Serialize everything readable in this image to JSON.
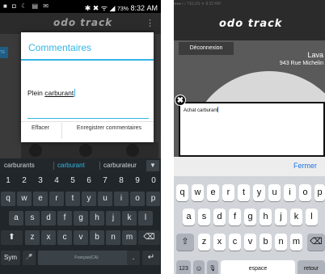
{
  "left_screen": {
    "status_bar": {
      "icons_left": "■ ◘ ☾ ▤ ✉",
      "icons_right": "✱ ✖ ᯤ ◢",
      "battery": "73%",
      "time": "8:32 AM"
    },
    "header": {
      "logo": "odo track",
      "menu_icon": "⋮",
      "edge_tab": "TE"
    },
    "dialog": {
      "title": "Commentaires",
      "text_prefix": "Plein ",
      "text_underlined": "carburant",
      "btn_clear": "Effacer",
      "btn_save": "Enregistrer commentaires"
    },
    "suggestions": {
      "s1": "carburants",
      "s2": "carburant",
      "s3": "carburateur",
      "expand_icon": "chevron-down"
    },
    "keyboard": {
      "numbers": [
        "1",
        "2",
        "3",
        "4",
        "5",
        "6",
        "7",
        "8",
        "9",
        "0"
      ],
      "row1": [
        "q",
        "w",
        "e",
        "r",
        "t",
        "y",
        "u",
        "i",
        "o",
        "p"
      ],
      "row2": [
        "a",
        "s",
        "d",
        "f",
        "g",
        "h",
        "j",
        "k",
        "l"
      ],
      "row3": [
        "z",
        "x",
        "c",
        "v",
        "b",
        "n",
        "m"
      ],
      "shift": "⬆",
      "backspace": "⌫",
      "sym": "Sym",
      "mic": "🎤",
      "space": "Français(CA)",
      "period": ".",
      "enter": "↵"
    }
  },
  "right_screen": {
    "status_bar": "●●●○○ TELUS  ✈  8:32 AM",
    "header_logo": "odo track",
    "logout_button": "Déconnexion",
    "location_name": "Lava",
    "location_address": "943 Rue Michelin",
    "textbox_value": "Achat carburant",
    "close_icon": "✖",
    "fermer": "Fermer",
    "keyboard": {
      "row1": [
        "q",
        "w",
        "e",
        "r",
        "t",
        "y",
        "u",
        "i",
        "o",
        "p"
      ],
      "row2": [
        "a",
        "s",
        "d",
        "f",
        "g",
        "h",
        "j",
        "k",
        "l"
      ],
      "row3": [
        "z",
        "x",
        "c",
        "v",
        "b",
        "n",
        "m"
      ],
      "shift": "⇧",
      "backspace": "⌫",
      "numbers_key": "123",
      "emoji_key": "☺",
      "mic_key": "🎙",
      "space": "espace",
      "return": "retour"
    }
  }
}
